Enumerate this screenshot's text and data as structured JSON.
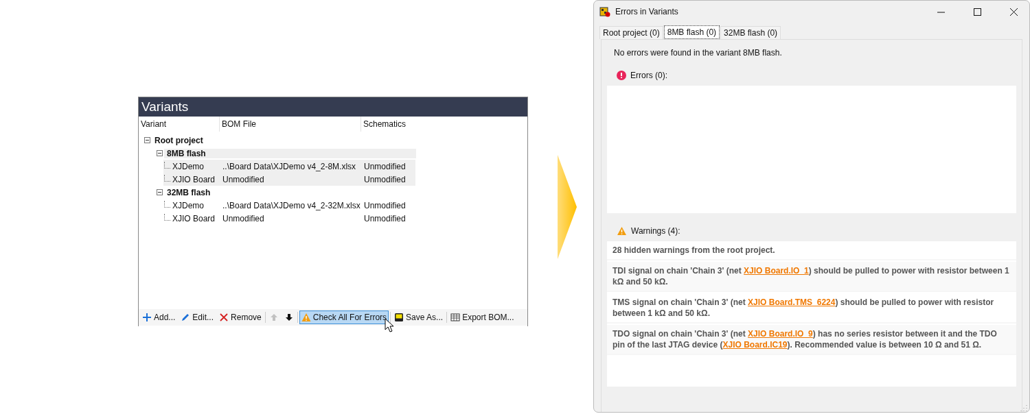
{
  "variants_panel": {
    "title": "Variants",
    "columns": [
      "Variant",
      "BOM File",
      "Schematics"
    ],
    "tree": [
      {
        "label": "Root project",
        "expanded": true,
        "children": [
          {
            "label": "8MB flash",
            "expanded": true,
            "selected": true,
            "children": [
              {
                "variant": "XJDemo",
                "bom_file": "..\\Board Data\\XJDemo v4_2-8M.xlsx",
                "schematics": "Unmodified"
              },
              {
                "variant": "XJIO Board",
                "bom_file": "Unmodified",
                "schematics": "Unmodified"
              }
            ]
          },
          {
            "label": "32MB flash",
            "expanded": true,
            "selected": false,
            "children": [
              {
                "variant": "XJDemo",
                "bom_file": "..\\Board Data\\XJDemo v4_2-32M.xlsx",
                "schematics": "Unmodified"
              },
              {
                "variant": "XJIO Board",
                "bom_file": "Unmodified",
                "schematics": "Unmodified"
              }
            ]
          }
        ]
      }
    ],
    "toolbar": [
      {
        "kind": "add",
        "label": "Add...",
        "selected": false,
        "disabled": false
      },
      {
        "kind": "edit",
        "label": "Edit...",
        "selected": false,
        "disabled": false
      },
      {
        "kind": "remove",
        "label": "Remove",
        "selected": false,
        "disabled": false
      },
      {
        "kind": "separator"
      },
      {
        "kind": "up",
        "selected": false,
        "disabled": true
      },
      {
        "kind": "down",
        "selected": false,
        "disabled": false
      },
      {
        "kind": "separator"
      },
      {
        "kind": "check",
        "label": "Check All For Errors",
        "selected": true,
        "disabled": false
      },
      {
        "kind": "separator"
      },
      {
        "kind": "save",
        "label": "Save As...",
        "selected": false,
        "disabled": false
      },
      {
        "kind": "separator"
      },
      {
        "kind": "export",
        "label": "Export BOM...",
        "selected": false,
        "disabled": false
      }
    ]
  },
  "dialog": {
    "title": "Errors in Variants",
    "tabs": [
      {
        "label": "Root project (0)",
        "selected": false
      },
      {
        "label": "8MB flash (0)",
        "selected": true
      },
      {
        "label": "32MB flash (0)",
        "selected": false
      }
    ],
    "summary": "No errors were found in the variant 8MB flash.",
    "errors": {
      "heading": "Errors (0):"
    },
    "warnings": {
      "heading": "Warnings (4):",
      "items": [
        [
          {
            "kind": "text",
            "text": "28 hidden warnings from the root project."
          }
        ],
        [
          {
            "kind": "text",
            "text": "TDI signal on chain 'Chain 3' (net "
          },
          {
            "kind": "link",
            "text": "XJIO Board.IO_1"
          },
          {
            "kind": "text",
            "text": ") should be pulled to power with resistor between 1 kΩ and 50 kΩ."
          }
        ],
        [
          {
            "kind": "text",
            "text": "TMS signal on chain 'Chain 3' (net "
          },
          {
            "kind": "link",
            "text": "XJIO Board.TMS_6224"
          },
          {
            "kind": "text",
            "text": ") should be pulled to power with resistor between 1 kΩ and 50 kΩ."
          }
        ],
        [
          {
            "kind": "text",
            "text": "TDO signal on chain 'Chain 3' (net "
          },
          {
            "kind": "link",
            "text": "XJIO Board.IO_9"
          },
          {
            "kind": "text",
            "text": ") has no series resistor between it and the TDO pin of the last JTAG device ("
          },
          {
            "kind": "link",
            "text": "XJIO Board.IC19"
          },
          {
            "kind": "text",
            "text": "). Recommended value is between 10 Ω and 51 Ω."
          }
        ]
      ]
    }
  }
}
